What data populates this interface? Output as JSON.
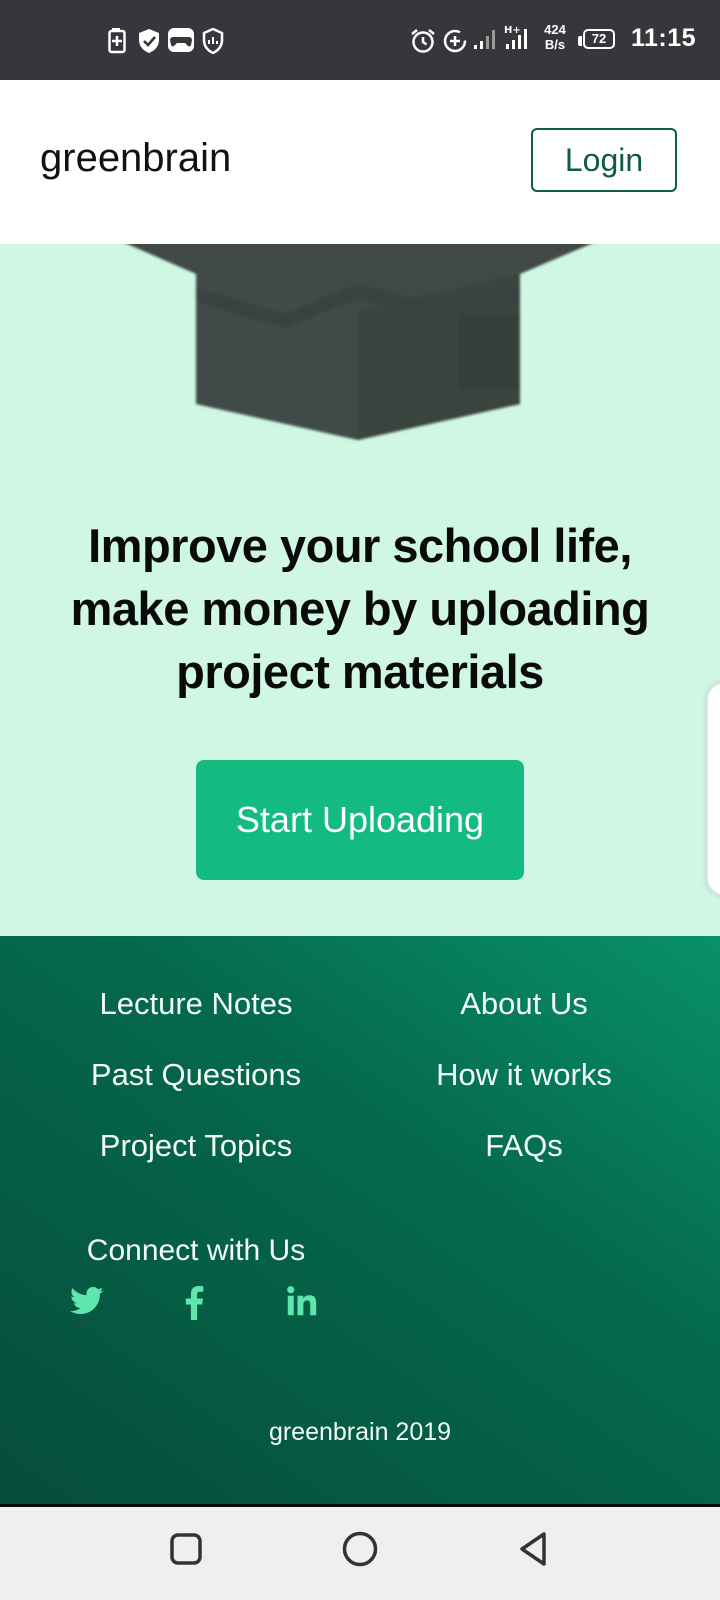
{
  "status_bar": {
    "time": "11:15",
    "net_speed_value": "424",
    "net_speed_unit": "B/s",
    "battery": "72",
    "icons": [
      "battery-saver-icon",
      "shield-check-icon",
      "gamepad-icon",
      "shield-chart-icon",
      "alarm-icon",
      "data-saver-icon",
      "signal-icon",
      "signal-h-plus-icon",
      "battery-icon"
    ]
  },
  "header": {
    "brand": "greenbrain",
    "login_label": "Login"
  },
  "hero": {
    "headline_lines": [
      "Improve your school life,",
      "make money by uploading",
      "project materials"
    ],
    "cta_label": "Start Uploading"
  },
  "footer": {
    "links_left": [
      "Lecture Notes",
      "Past Questions",
      "Project Topics"
    ],
    "links_right": [
      "About Us",
      "How it works",
      "FAQs"
    ],
    "connect_label": "Connect with Us",
    "social_icons": [
      "twitter-icon",
      "facebook-icon",
      "linkedin-icon"
    ],
    "copyright": "greenbrain 2019"
  },
  "colors": {
    "hero_bg": "#cff7e3",
    "cta_green": "#13bb83",
    "footer_dark": "#064d3b",
    "social_icon": "#5ee6ad",
    "login_border": "#0f5c44"
  },
  "nav_buttons": [
    "recents-square-icon",
    "home-circle-icon",
    "back-triangle-icon"
  ]
}
